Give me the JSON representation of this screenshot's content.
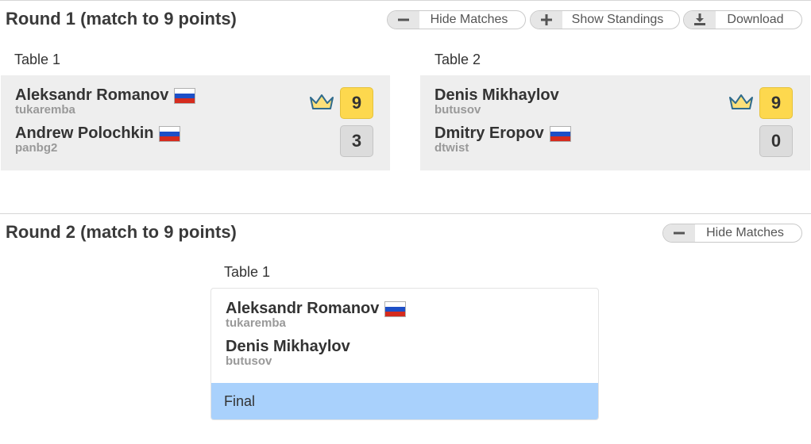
{
  "round1": {
    "title": "Round 1 (match to 9 points)",
    "buttons": {
      "hide_matches": "Hide Matches",
      "show_standings": "Show Standings",
      "download": "Download"
    },
    "tables": [
      {
        "label": "Table 1",
        "players": [
          {
            "name": "Aleksandr Romanov",
            "username": "tukaremba",
            "flag": "Russia",
            "score": "9",
            "winner": true
          },
          {
            "name": "Andrew Polochkin",
            "username": "panbg2",
            "flag": "Russia",
            "score": "3",
            "winner": false
          }
        ]
      },
      {
        "label": "Table 2",
        "players": [
          {
            "name": "Denis Mikhaylov",
            "username": "butusov",
            "flag": "",
            "score": "9",
            "winner": true
          },
          {
            "name": "Dmitry Eropov",
            "username": "dtwist",
            "flag": "Russia",
            "score": "0",
            "winner": false
          }
        ]
      }
    ]
  },
  "round2": {
    "title": "Round 2 (match to 9 points)",
    "buttons": {
      "hide_matches": "Hide Matches"
    },
    "tables": [
      {
        "label": "Table 1",
        "players": [
          {
            "name": "Aleksandr Romanov",
            "username": "tukaremba",
            "flag": "Russia"
          },
          {
            "name": "Denis Mikhaylov",
            "username": "butusov",
            "flag": ""
          }
        ],
        "status": "Final"
      }
    ]
  },
  "colors": {
    "winner_score": "#fdd84e",
    "loser_score": "#dcdcdc",
    "final_bar": "#a9d1fc",
    "card_bg": "#eeeeee"
  },
  "icons": [
    "minus-icon",
    "plus-icon",
    "download-icon",
    "crown-icon",
    "russia-flag-icon"
  ]
}
